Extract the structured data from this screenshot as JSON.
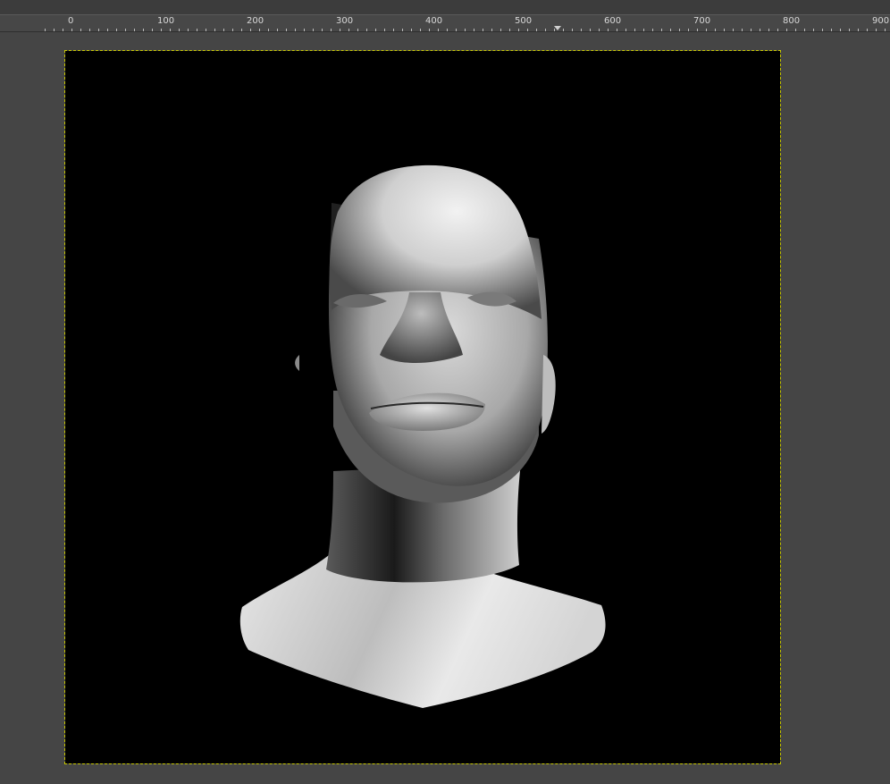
{
  "ruler": {
    "labels": [
      "0",
      "100",
      "200",
      "300",
      "400",
      "500",
      "600",
      "700",
      "800",
      "900"
    ]
  },
  "canvas": {
    "background": "#000000",
    "boundary_color": "#c8c800",
    "image_subject": "rendered-head-bust"
  },
  "colors": {
    "workspace": "#454545",
    "ruler_bg": "#474747",
    "ruler_text": "#d8d8d8"
  }
}
